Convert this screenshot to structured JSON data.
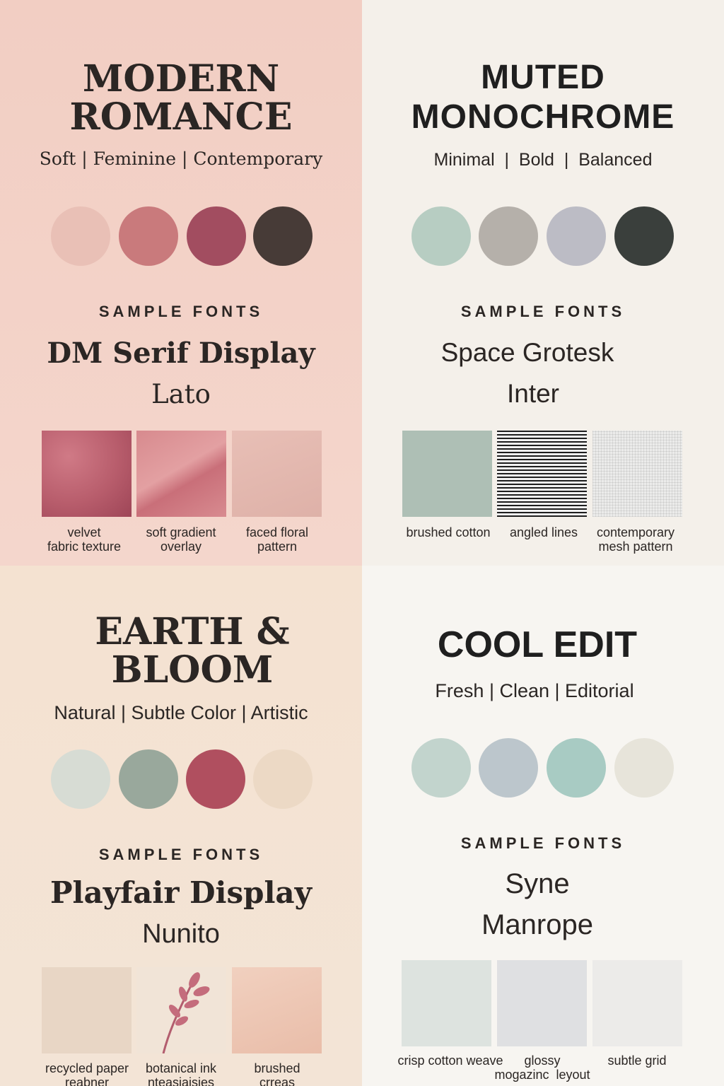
{
  "panels": [
    {
      "title_line1": "MODERN",
      "title_line2": "ROMANCE",
      "tagline": "Soft | Feminine | Contemporary",
      "fonts_heading": "SAMPLE FONTS",
      "font1": "DM Serif Display",
      "font2": "Lato",
      "swatches": [
        "#e9c0b6",
        "#c97a7c",
        "#a24d60",
        "#473b37"
      ],
      "captions": [
        "velvet\nfabric texture",
        "soft gradient\noverlay",
        "faced floral\npattern"
      ],
      "background": "#f3d3c9"
    },
    {
      "title_line1": "MUTED",
      "title_line2": "MONOCHROME",
      "tagline": "Minimal  |  Bold  |  Balanced",
      "fonts_heading": "SAMPLE FONTS",
      "font1": "Space Grotesk",
      "font2": "Inter",
      "swatches": [
        "#b7cdc2",
        "#b5b0aa",
        "#bcbcc5",
        "#3a3f3c"
      ],
      "captions": [
        "brushed cotton",
        "angled lines",
        "contemporary\nmesh pattern"
      ],
      "background": "#f4f0ea"
    },
    {
      "title_line1": "EARTH &",
      "title_line2": "BLOOM",
      "tagline": "Natural | Subtle Color | Artistic",
      "fonts_heading": "SAMPLE FONTS",
      "font1": "Playfair Display",
      "font2": "Nunito",
      "swatches": [
        "#d7dcd4",
        "#99a89c",
        "#b04f5f",
        "#ecd9c5"
      ],
      "captions": [
        "recycled paper\nreabner",
        "botanical ink\nnteasiaisies",
        "brushed\ncrreas"
      ],
      "background": "#f4e4d4"
    },
    {
      "title_line1": "COOL EDIT",
      "tagline": "Fresh | Clean | Editorial",
      "fonts_heading": "SAMPLE FONTS",
      "font1": "Syne",
      "font2": "Manrope",
      "swatches": [
        "#c2d4cd",
        "#bcc6cc",
        "#a8cbc3",
        "#e7e4da"
      ],
      "captions": [
        "crisp cotton weave",
        "glossy\nmogazinc  leyout",
        "subtle grid"
      ],
      "background": "#f6f4f0"
    }
  ]
}
